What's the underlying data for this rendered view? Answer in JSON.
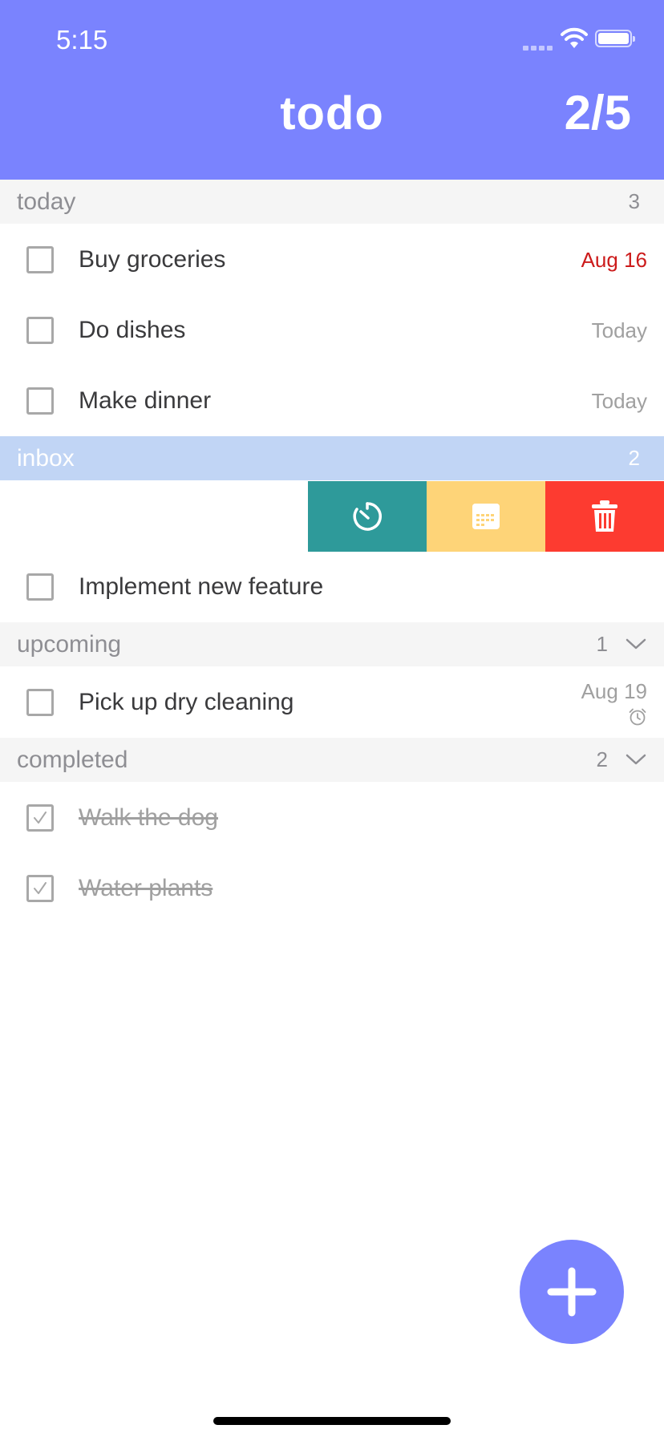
{
  "status_bar": {
    "time": "5:15"
  },
  "header": {
    "title": "todo",
    "progress": "2/5",
    "color": "#7a83fe"
  },
  "sections": {
    "today": {
      "name": "today",
      "count": "3"
    },
    "inbox": {
      "name": "inbox",
      "count": "2"
    },
    "upcoming": {
      "name": "upcoming",
      "count": "1"
    },
    "completed": {
      "name": "completed",
      "count": "2"
    }
  },
  "tasks": {
    "today": [
      {
        "label": "Buy groceries",
        "date": "Aug 16",
        "status": "overdue"
      },
      {
        "label": "Do dishes",
        "date": "Today"
      },
      {
        "label": "Make dinner",
        "date": "Today"
      }
    ],
    "inbox": [
      {
        "label": "Implement new feature"
      }
    ],
    "upcoming": [
      {
        "label": "Pick up dry cleaning",
        "date": "Aug 19",
        "reminder_icon": "alarm-icon"
      }
    ],
    "completed": [
      {
        "label": "Walk the dog",
        "checked": true
      },
      {
        "label": "Water plants",
        "checked": true
      }
    ]
  },
  "swipe_actions": [
    {
      "name": "snooze",
      "icon": "timer-icon",
      "color": "#2e9a9a"
    },
    {
      "name": "schedule",
      "icon": "calendar-icon",
      "color": "#fed478"
    },
    {
      "name": "delete",
      "icon": "trash-icon",
      "color": "#fd3b30"
    }
  ],
  "fab": {
    "icon": "plus-icon",
    "color": "#7a83fe"
  },
  "colors": {
    "overdue": "#cc1b1b",
    "muted": "#a0a0a0",
    "inbox_header": "#c1d5f5"
  }
}
